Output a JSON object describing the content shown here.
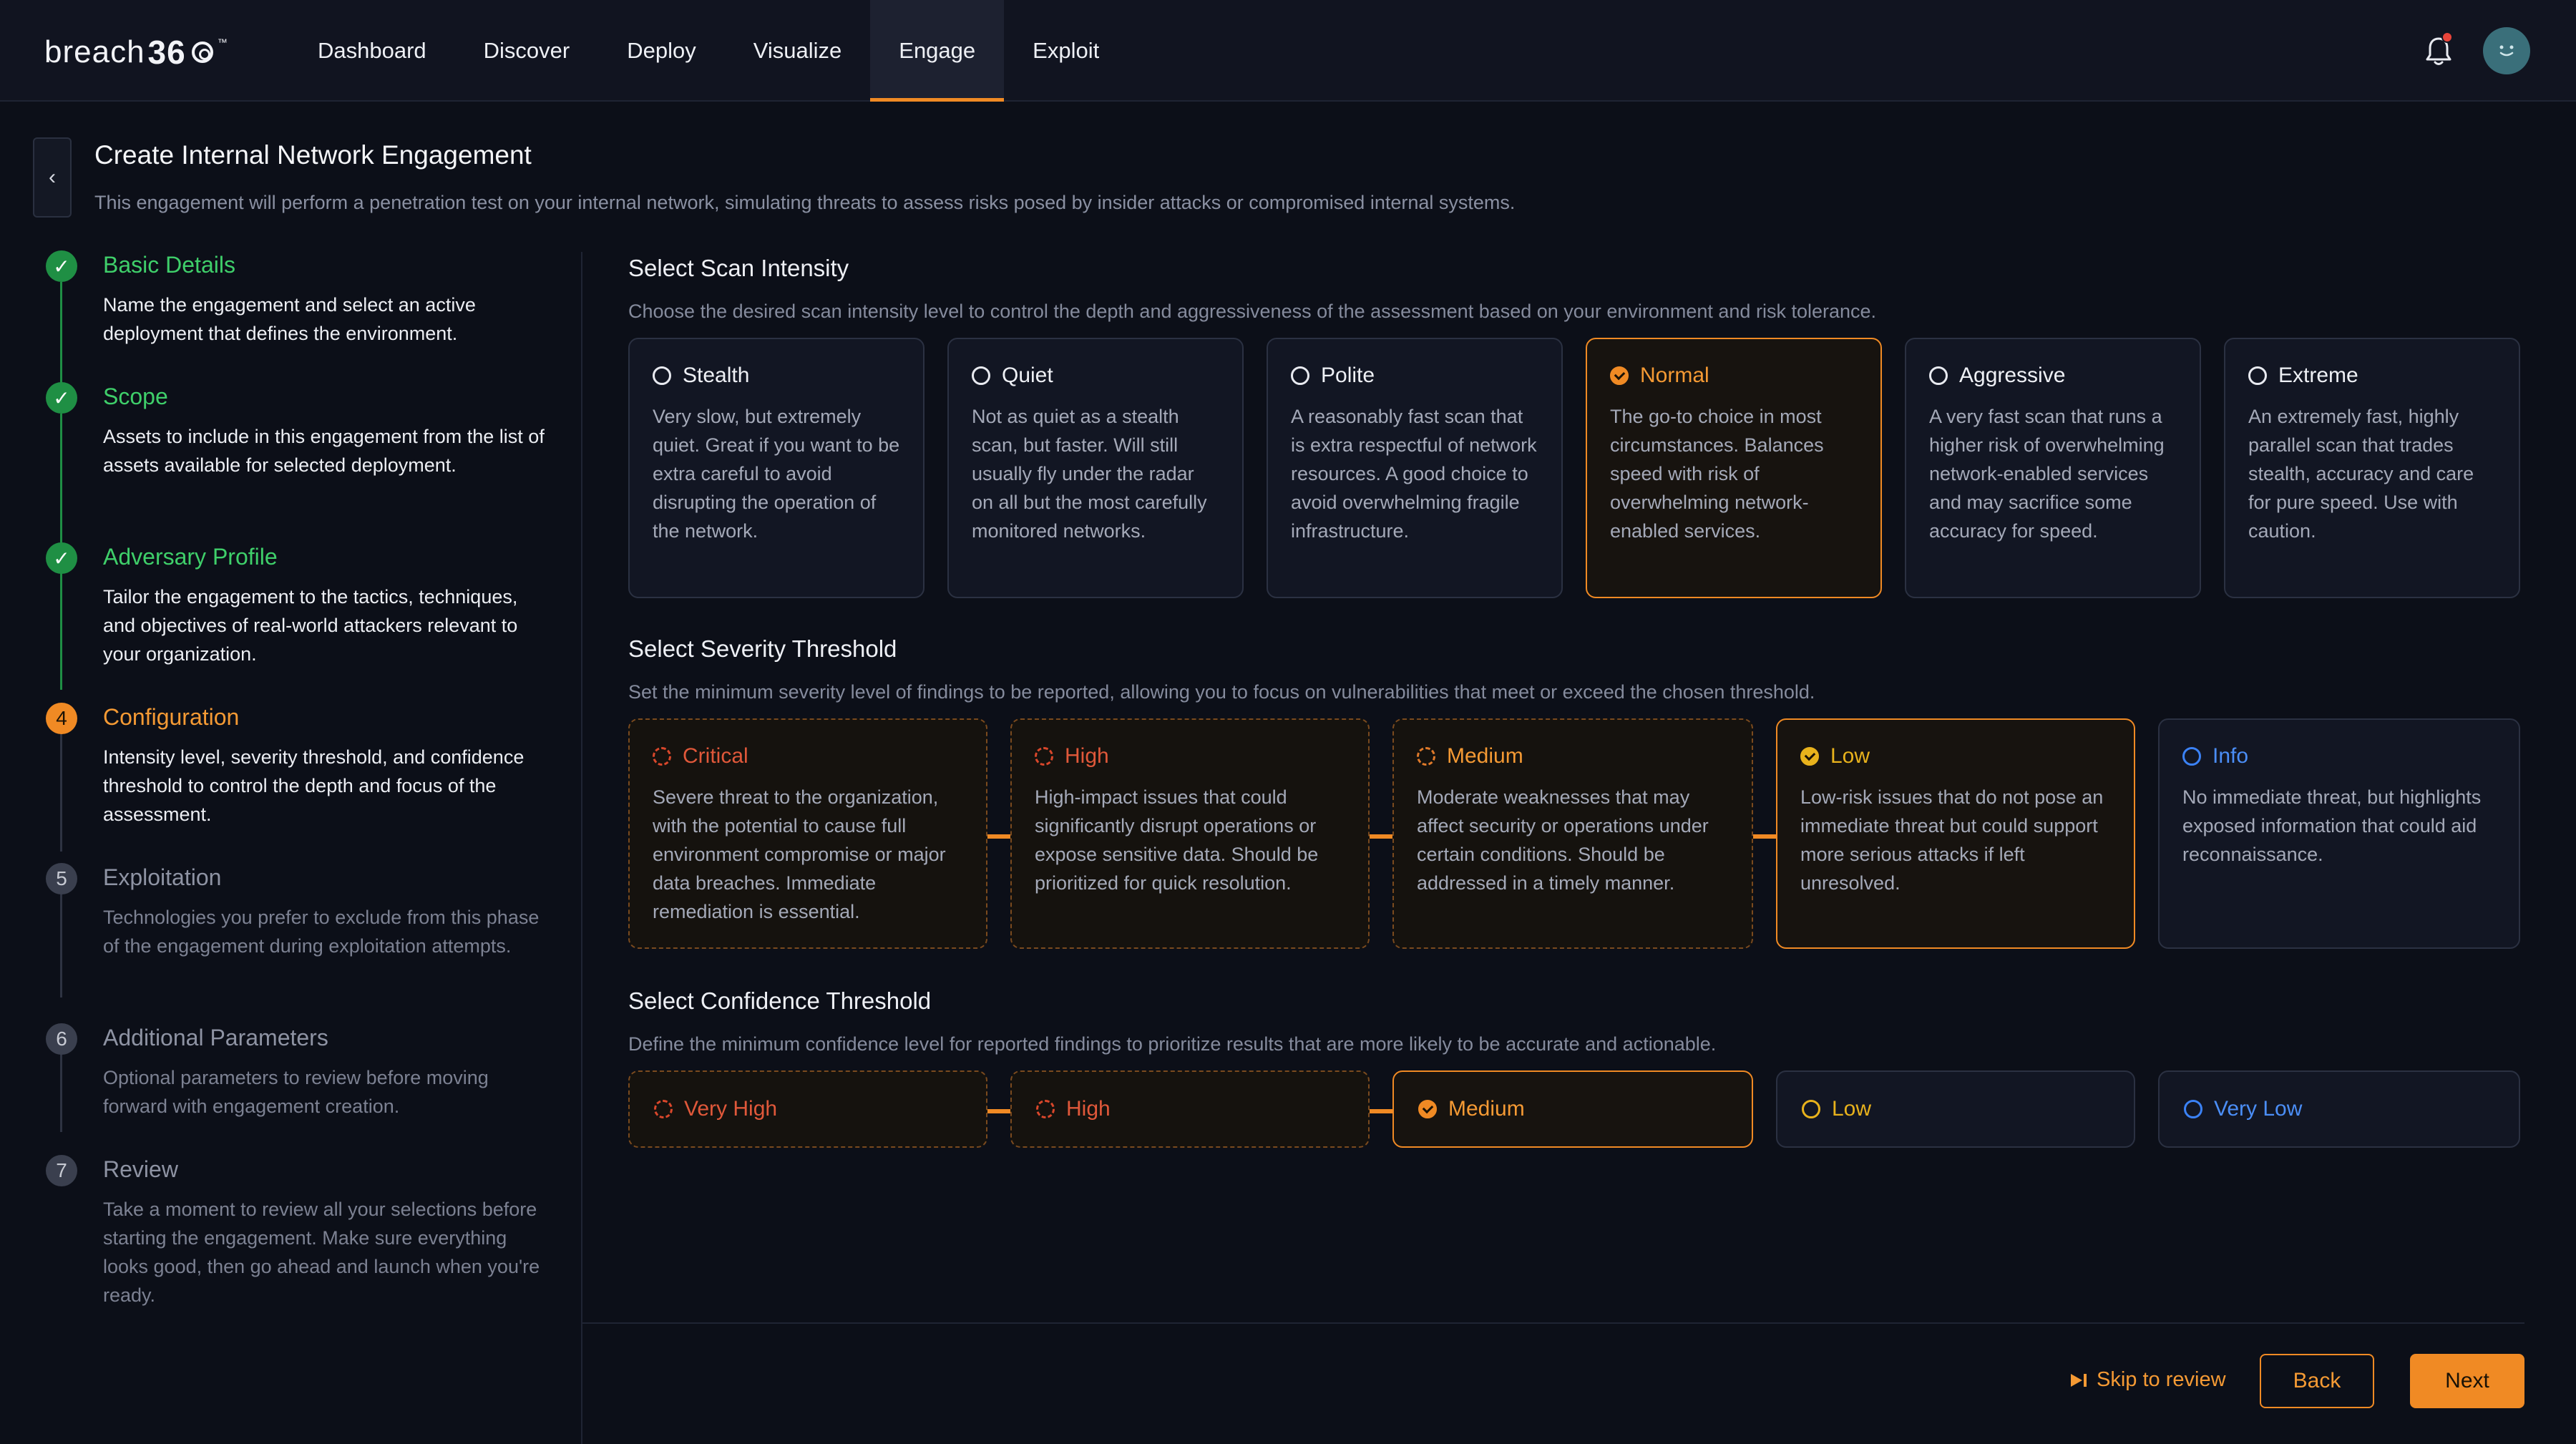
{
  "app": {
    "logo_text": "breach",
    "logo_num": "36",
    "logo_tm": "™",
    "nav": [
      {
        "label": "Dashboard"
      },
      {
        "label": "Discover"
      },
      {
        "label": "Deploy"
      },
      {
        "label": "Visualize"
      },
      {
        "label": "Engage",
        "active": true
      },
      {
        "label": "Exploit"
      }
    ]
  },
  "header": {
    "back_glyph": "‹",
    "title": "Create Internal Network Engagement",
    "subtitle": "This engagement will perform a penetration test on your internal network, simulating threats to assess risks posed by insider attacks or compromised internal systems."
  },
  "steps": [
    {
      "num": "✓",
      "state": "done",
      "title": "Basic Details",
      "desc": "Name the engagement and select an active deployment that defines the environment."
    },
    {
      "num": "✓",
      "state": "done",
      "title": "Scope",
      "desc": "Assets to include in this engagement from the list of assets available for selected deployment."
    },
    {
      "num": "✓",
      "state": "done",
      "title": "Adversary Profile",
      "desc": "Tailor the engagement to the tactics, techniques, and objectives of real-world attackers relevant to your organization."
    },
    {
      "num": "4",
      "state": "current",
      "title": "Configuration",
      "desc": "Intensity level, severity threshold, and confidence threshold to control the depth and focus of the assessment."
    },
    {
      "num": "5",
      "state": "todo",
      "title": "Exploitation",
      "desc": "Technologies you prefer to exclude from this phase of the engagement during exploitation attempts."
    },
    {
      "num": "6",
      "state": "todo",
      "title": "Additional Parameters",
      "desc": "Optional parameters to review before moving forward with engagement creation."
    },
    {
      "num": "7",
      "state": "todo",
      "title": "Review",
      "desc": "Take a moment to review all your selections before starting the engagement. Make sure everything looks good, then go ahead and launch when you're ready."
    }
  ],
  "scan_intensity": {
    "title": "Select Scan Intensity",
    "desc": "Choose the desired scan intensity level to control the depth and aggressiveness of the assessment based on your environment and risk tolerance.",
    "options": [
      {
        "label": "Stealth",
        "text": "Very slow, but extremely quiet. Great if you want to be extra careful to avoid disrupting the operation of the network."
      },
      {
        "label": "Quiet",
        "text": "Not as quiet as a stealth scan, but faster. Will still usually fly under the radar on all but the most carefully monitored networks."
      },
      {
        "label": "Polite",
        "text": "A reasonably fast scan that is extra respectful of network resources. A good choice to avoid overwhelming fragile infrastructure."
      },
      {
        "label": "Normal",
        "text": "The go-to choice in most circumstances. Balances speed with risk of overwhelming network-enabled services.",
        "selected": true
      },
      {
        "label": "Aggressive",
        "text": "A very fast scan that runs a higher risk of overwhelming network-enabled services and may sacrifice some accuracy for speed."
      },
      {
        "label": "Extreme",
        "text": "An extremely fast, highly parallel scan that trades stealth, accuracy and care for pure speed. Use with caution."
      }
    ]
  },
  "severity": {
    "title": "Select Severity Threshold",
    "desc": "Set the minimum severity level of findings to be reported, allowing you to focus on vulnerabilities that meet or exceed the chosen threshold.",
    "options": [
      {
        "label": "Critical",
        "text": "Severe threat to the organization, with the potential to cause full environment compromise or major data breaches. Immediate remediation is essential."
      },
      {
        "label": "High",
        "text": "High-impact issues that could significantly disrupt operations or expose sensitive data. Should be prioritized for quick resolution."
      },
      {
        "label": "Medium",
        "text": "Moderate weaknesses that may affect security or operations under certain conditions. Should be addressed in a timely manner."
      },
      {
        "label": "Low",
        "text": "Low-risk issues that do not pose an immediate threat but could support more serious attacks if left unresolved.",
        "selected": true
      },
      {
        "label": "Info",
        "text": "No immediate threat, but highlights exposed information that could aid reconnaissance."
      }
    ]
  },
  "confidence": {
    "title": "Select Confidence Threshold",
    "desc": "Define the minimum confidence level for reported findings to prioritize results that are more likely to be accurate and actionable.",
    "options": [
      {
        "label": "Very High"
      },
      {
        "label": "High"
      },
      {
        "label": "Medium",
        "selected": true
      },
      {
        "label": "Low"
      },
      {
        "label": "Very Low"
      }
    ]
  },
  "footer": {
    "skip_label": "Skip to review",
    "back_label": "Back",
    "next_label": "Next"
  },
  "colors": {
    "accent": "#f08a24",
    "success": "#3fcf6a",
    "critical": "#e0583a",
    "low": "#e8b21c",
    "info": "#4b8ef7"
  }
}
